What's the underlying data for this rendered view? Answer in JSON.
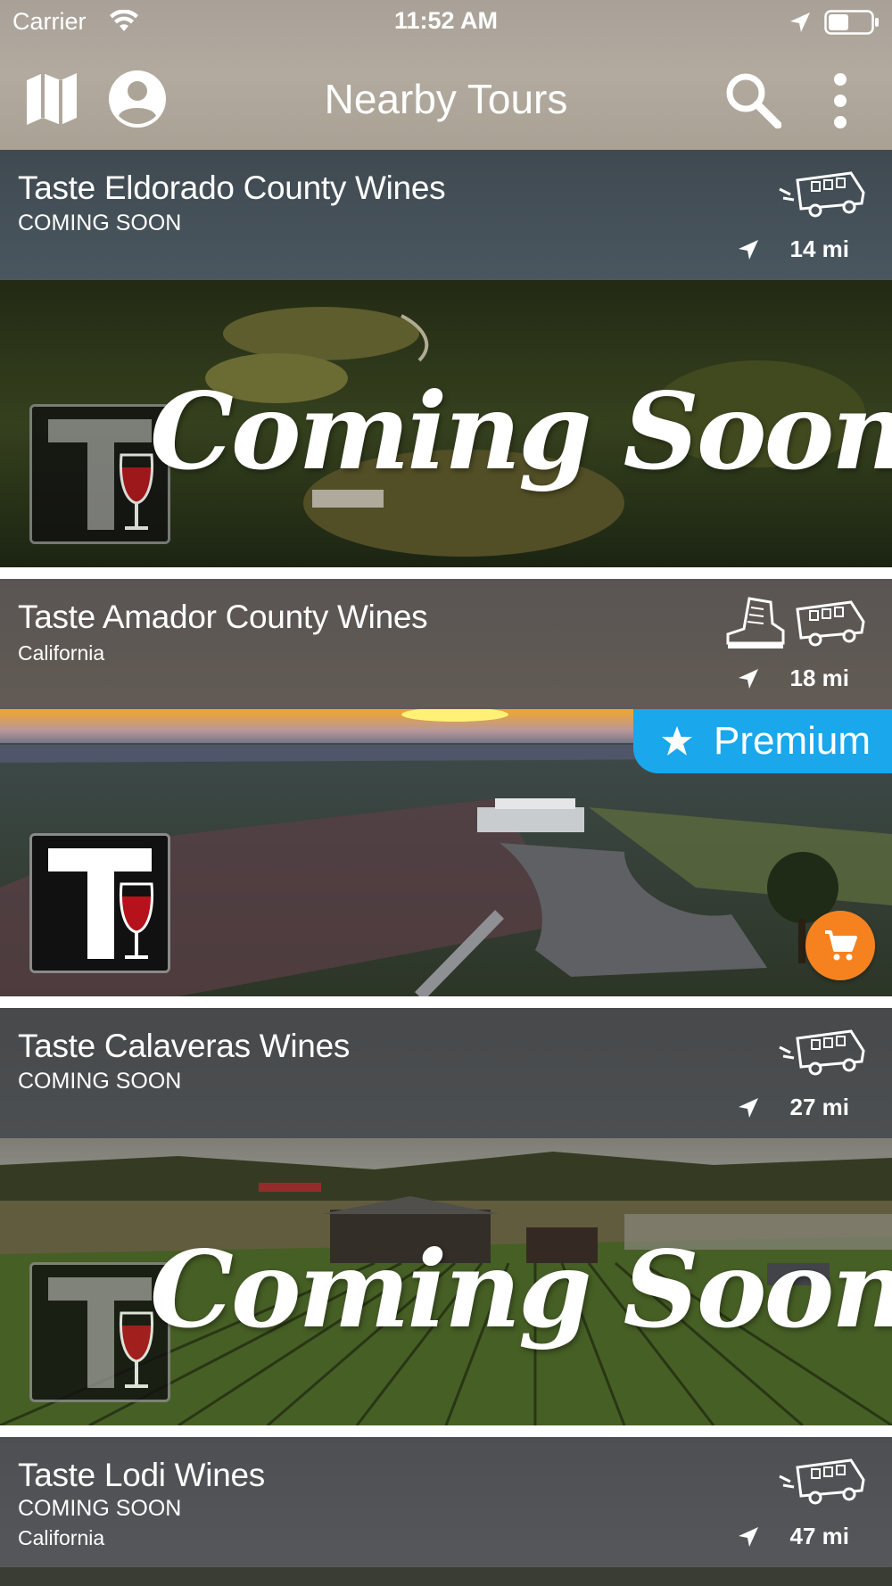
{
  "status_bar": {
    "carrier": "Carrier",
    "time": "11:52 AM"
  },
  "nav": {
    "title": "Nearby Tours",
    "icons": {
      "left": [
        "map-icon",
        "account-icon"
      ],
      "right": [
        "search-icon",
        "more-vert-icon"
      ]
    }
  },
  "tours": [
    {
      "name": "Taste Eldorado County Wines",
      "status": "COMING SOON",
      "region": "",
      "distance": "14 mi",
      "transport_icons": [
        "vehicle-icon"
      ],
      "image_overlay": "Coming Soon!",
      "premium": false
    },
    {
      "name": "Taste Amador County Wines",
      "status": "",
      "region": "California",
      "distance": "18 mi",
      "transport_icons": [
        "hiking-boot-icon",
        "vehicle-icon"
      ],
      "image_overlay": "",
      "premium": true,
      "premium_label": "Premium"
    },
    {
      "name": "Taste Calaveras Wines",
      "status": "COMING SOON",
      "region": "",
      "distance": "27 mi",
      "transport_icons": [
        "vehicle-icon"
      ],
      "image_overlay": "Coming Soon!",
      "premium": false
    },
    {
      "name": "Taste Lodi Wines",
      "status": "COMING SOON",
      "region": "California",
      "distance": "47 mi",
      "transport_icons": [
        "vehicle-icon"
      ],
      "image_overlay": "",
      "premium": false
    }
  ],
  "colors": {
    "premium_badge": "#1aa7ec",
    "cart_button": "#f5821f",
    "wine_red": "#b5121b"
  }
}
